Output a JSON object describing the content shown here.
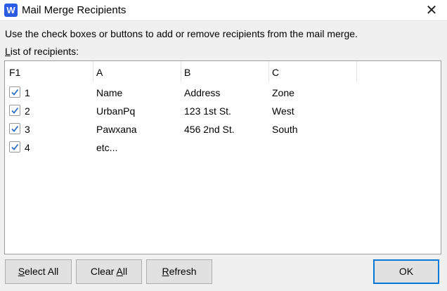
{
  "window": {
    "title": "Mail Merge Recipients",
    "app_icon_letter": "W"
  },
  "instructions": "Use the check boxes or buttons to add or remove recipients from the mail merge.",
  "list_label": {
    "accel": "L",
    "rest": "ist of recipients:"
  },
  "columns": [
    "F1",
    "A",
    "B",
    "C"
  ],
  "rows": [
    {
      "checked": true,
      "cells": [
        "1",
        "Name",
        "Address",
        "Zone"
      ]
    },
    {
      "checked": true,
      "cells": [
        "2",
        "UrbanPq",
        "123 1st St.",
        "West"
      ]
    },
    {
      "checked": true,
      "cells": [
        "3",
        "Pawxana",
        "456 2nd St.",
        "South"
      ]
    },
    {
      "checked": true,
      "cells": [
        "4",
        "etc...",
        "",
        ""
      ]
    }
  ],
  "buttons": {
    "select_all": {
      "pre": "",
      "accel": "S",
      "post": "elect All"
    },
    "clear_all": {
      "pre": "Clear ",
      "accel": "A",
      "post": "ll"
    },
    "refresh": {
      "pre": "",
      "accel": "R",
      "post": "efresh"
    },
    "ok": "OK"
  },
  "colors": {
    "accent": "#0078d7",
    "check": "#2b6cc4"
  }
}
